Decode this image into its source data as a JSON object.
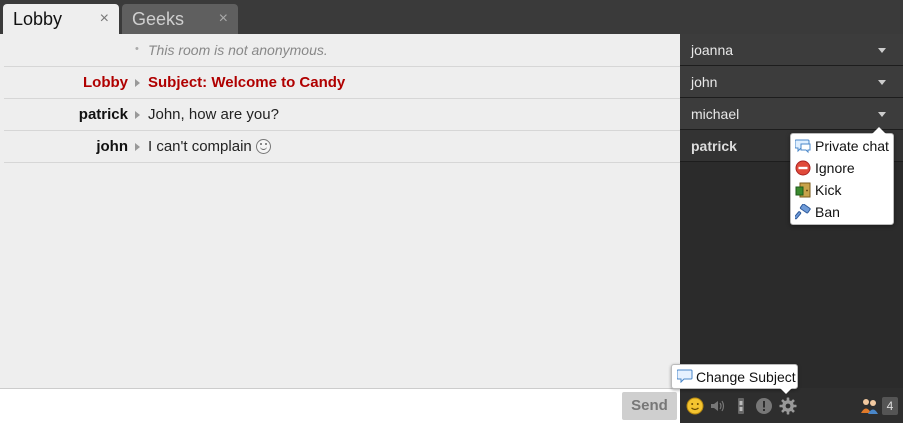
{
  "tabs": [
    {
      "label": "Lobby",
      "close": "×"
    },
    {
      "label": "Geeks",
      "close": "×"
    }
  ],
  "messages": [
    {
      "type": "info",
      "text": "This room is not anonymous."
    },
    {
      "type": "subject",
      "name": "Lobby",
      "text": "Subject: Welcome to Candy"
    },
    {
      "type": "message",
      "name": "patrick",
      "text": "John, how are you?"
    },
    {
      "type": "message",
      "name": "john",
      "text": "I can't complain"
    }
  ],
  "input": {
    "value": "",
    "placeholder": ""
  },
  "send_label": "Send",
  "roster": [
    {
      "name": "joanna"
    },
    {
      "name": "john"
    },
    {
      "name": "michael"
    },
    {
      "name": "patrick"
    }
  ],
  "context_menu": {
    "items": [
      {
        "label": "Private chat",
        "icon": "speech-bubble-icon"
      },
      {
        "label": "Ignore",
        "icon": "ignore-icon"
      },
      {
        "label": "Kick",
        "icon": "kick-door-icon"
      },
      {
        "label": "Ban",
        "icon": "ban-hammer-icon"
      }
    ]
  },
  "tooltip": {
    "label": "Change Subject",
    "icon": "speech-bubble-icon"
  },
  "toolbar": {
    "icons": [
      "emoticons-icon",
      "sound-icon",
      "autoscroll-icon",
      "statusmessage-icon",
      "settings-gear-icon",
      "usercount-icon"
    ],
    "usercount": "4"
  },
  "colors": {
    "accent_red": "#b00000",
    "panel_dark": "#2b2b2b",
    "chat_bg": "#eeeeee"
  }
}
